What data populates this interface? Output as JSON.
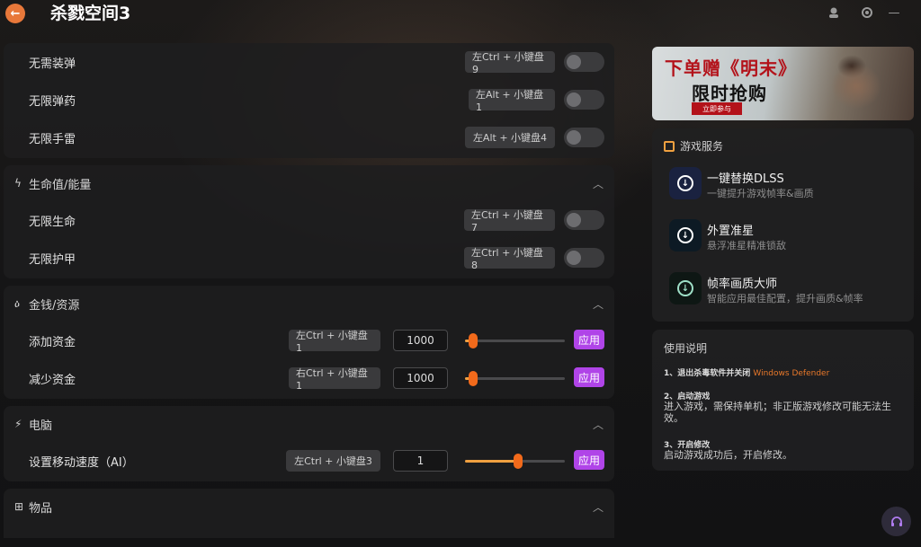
{
  "app": {
    "title": "杀戮空间3"
  },
  "window_controls": {
    "user_icon": "user-icon",
    "settings_icon": "gear-icon",
    "minimize": "—"
  },
  "sections": [
    {
      "title": "",
      "rows": [
        {
          "label": "无需装弹",
          "hotkey": "左Ctrl + 小键盘9"
        },
        {
          "label": "无限弹药",
          "hotkey": "左Alt + 小键盘1"
        },
        {
          "label": "无限手雷",
          "hotkey": "左Alt + 小键盘4"
        }
      ]
    },
    {
      "title": "生命值/能量",
      "icon": "lightning-icon",
      "rows": [
        {
          "label": "无限生命",
          "hotkey": "左Ctrl + 小键盘7"
        },
        {
          "label": "无限护甲",
          "hotkey": "左Ctrl + 小键盘8"
        }
      ]
    },
    {
      "title": "金钱/资源",
      "icon": "money-bag-icon",
      "rows": [
        {
          "label": "添加资金",
          "hotkey": "左Ctrl + 小键盘1",
          "value": "1000",
          "slider": 0.08,
          "apply": "应用"
        },
        {
          "label": "减少资金",
          "hotkey": "右Ctrl + 小键盘1",
          "value": "1000",
          "slider": 0.08,
          "apply": "应用"
        }
      ]
    },
    {
      "title": "电脑",
      "icon": "running-icon",
      "rows": [
        {
          "label": "设置移动速度（AI）",
          "hotkey": "左Ctrl + 小键盘3",
          "value": "1",
          "slider": 0.53,
          "apply": "应用"
        }
      ]
    },
    {
      "title": "物品",
      "icon": "plus-box-icon",
      "rows": []
    }
  ],
  "banner": {
    "line1": "下单赠《明末》",
    "line2": "限时抢购",
    "button": "立即参与"
  },
  "services": {
    "title": "游戏服务",
    "items": [
      {
        "name": "一键替换DLSS",
        "desc": "一键提升游戏帧率&画质"
      },
      {
        "name": "外置准星",
        "desc": "悬浮准星精准锁敌"
      },
      {
        "name": "帧率画质大师",
        "desc": "智能应用最佳配置，提升画质&帧率"
      }
    ]
  },
  "help": {
    "title": "使用说明",
    "step1": "1、退出杀毒软件并关闭",
    "step1_highlight": "Windows Defender",
    "step2": "2、启动游戏",
    "step2_body": "进入游戏，需保持单机；非正版游戏修改可能无法生效。",
    "step3": "3、开启修改",
    "step3_body": "启动游戏成功后，开启修改。"
  },
  "colors": {
    "accent": "#f26a1b",
    "apply": "#b044e8",
    "highlight": "#e8782a"
  }
}
